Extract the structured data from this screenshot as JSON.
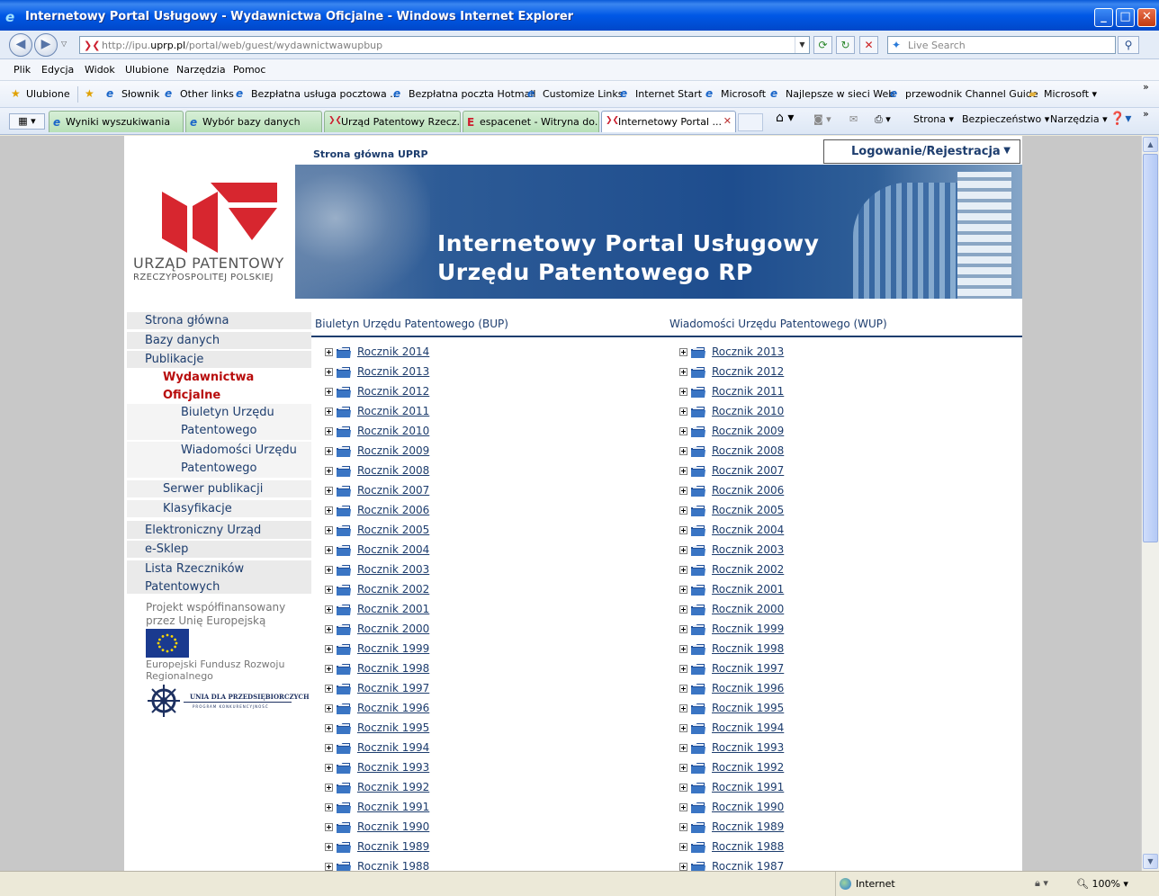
{
  "window": {
    "title": "Internetowy Portal Usługowy - Wydawnictwa Oficjalne - Windows Internet Explorer"
  },
  "address_bar": {
    "url_prefix": "http://ipu.",
    "url_domain": "uprp.pl",
    "url_path": "/portal/web/guest/wydawnictwawupbup",
    "search_placeholder": "Live Search"
  },
  "menu": [
    "Plik",
    "Edycja",
    "Widok",
    "Ulubione",
    "Narzędzia",
    "Pomoc"
  ],
  "favorites": {
    "label": "Ulubione",
    "items": [
      "Słownik",
      "Other links",
      "Bezpłatna usługa pocztowa ...",
      "Bezpłatna poczta Hotmail",
      "Customize Links",
      "Internet Start",
      "Microsoft",
      "Najlepsze w sieci Web",
      "przewodnik Channel Guide",
      "Microsoft"
    ]
  },
  "tabs": [
    "Wyniki wyszukiwania",
    "Wybór bazy danych",
    "Urząd Patentowy Rzecz...",
    "espacenet - Witryna do...",
    "Internetowy Portal ..."
  ],
  "command_bar": {
    "strona": "Strona",
    "bezpieczenstwo": "Bezpieczeństwo",
    "narzedzia": "Narzędzia"
  },
  "header": {
    "home_link": "Strona główna UPRP",
    "login": "Logowanie/Rejestracja",
    "logo_line1": "URZĄD PATENTOWY",
    "logo_line2": "RZECZYPOSPOLITEJ POLSKIEJ",
    "banner_line1": "Internetowy Portal Usługowy",
    "banner_line2": "Urzędu Patentowego RP"
  },
  "nav": {
    "strona_glowna": "Strona główna",
    "bazy_danych": "Bazy danych",
    "publikacje": "Publikacje",
    "wydawnictwa_1": "Wydawnictwa",
    "wydawnictwa_2": "Oficjalne",
    "bup_1": "Biuletyn Urzędu",
    "bup_2": "Patentowego",
    "wup_1": "Wiadomości Urzędu",
    "wup_2": "Patentowego",
    "serwer": "Serwer publikacji",
    "klasyfikacje": "Klasyfikacje",
    "elektroniczny": "Elektroniczny Urząd",
    "esklep": "e-Sklep",
    "rzecznicy_1": "Lista Rzeczników",
    "rzecznicy_2": "Patentowych"
  },
  "eu": {
    "project_1": "Projekt współfinansowany",
    "project_2": "przez Unię Europejską",
    "efrr_1": "Europejski Fundusz Rozwoju",
    "efrr_2": "Regionalnego",
    "unia_1": "UNIA DLA PRZEDSIĘBIORCZYCH",
    "unia_2": "PROGRAM KONKURENCYJNOŚĆ"
  },
  "content": {
    "bup_heading": "Biuletyn Urzędu Patentowego (BUP)",
    "wup_heading": "Wiadomości Urzędu Patentowego (WUP)",
    "bup_years": [
      "Rocznik 2014",
      "Rocznik 2013",
      "Rocznik 2012",
      "Rocznik 2011",
      "Rocznik 2010",
      "Rocznik 2009",
      "Rocznik 2008",
      "Rocznik 2007",
      "Rocznik 2006",
      "Rocznik 2005",
      "Rocznik 2004",
      "Rocznik 2003",
      "Rocznik 2002",
      "Rocznik 2001",
      "Rocznik 2000",
      "Rocznik 1999",
      "Rocznik 1998",
      "Rocznik 1997",
      "Rocznik 1996",
      "Rocznik 1995",
      "Rocznik 1994",
      "Rocznik 1993",
      "Rocznik 1992",
      "Rocznik 1991",
      "Rocznik 1990",
      "Rocznik 1989",
      "Rocznik 1988"
    ],
    "wup_years": [
      "Rocznik 2013",
      "Rocznik 2012",
      "Rocznik 2011",
      "Rocznik 2010",
      "Rocznik 2009",
      "Rocznik 2008",
      "Rocznik 2007",
      "Rocznik 2006",
      "Rocznik 2005",
      "Rocznik 2004",
      "Rocznik 2003",
      "Rocznik 2002",
      "Rocznik 2001",
      "Rocznik 2000",
      "Rocznik 1999",
      "Rocznik 1998",
      "Rocznik 1997",
      "Rocznik 1996",
      "Rocznik 1995",
      "Rocznik 1994",
      "Rocznik 1993",
      "Rocznik 1992",
      "Rocznik 1991",
      "Rocznik 1990",
      "Rocznik 1989",
      "Rocznik 1988",
      "Rocznik 1987"
    ]
  },
  "status": {
    "zone": "Internet",
    "zoom": "100%"
  },
  "icons": {
    "ie_logo": "ie-logo-icon",
    "folder": "folder-icon",
    "expand": "plus-box-icon",
    "search": "search-icon",
    "home": "home-icon",
    "rss": "rss-icon",
    "print": "print-icon",
    "help": "help-icon"
  },
  "colors": {
    "titlebar": "#0058e6",
    "link": "#1d3d6e",
    "active_nav": "#b80c0c",
    "logo_red": "#d7262f",
    "tab_green": "#b8e0b8"
  }
}
